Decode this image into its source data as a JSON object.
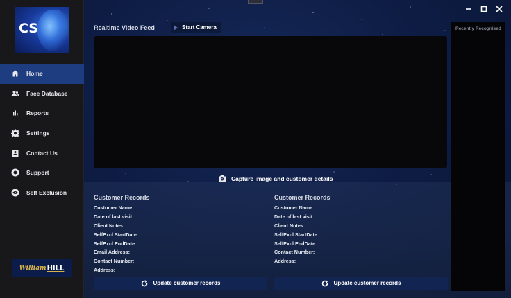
{
  "logo": {
    "text": "CS"
  },
  "brand": {
    "script": "William",
    "hill": "HILL"
  },
  "nav": {
    "items": [
      {
        "label": "Home",
        "icon": "home-icon",
        "active": true
      },
      {
        "label": "Face Database",
        "icon": "users-icon"
      },
      {
        "label": "Reports",
        "icon": "bar-chart-icon"
      },
      {
        "label": "Settings",
        "icon": "gear-icon"
      },
      {
        "label": "Contact Us",
        "icon": "contact-card-icon"
      },
      {
        "label": "Support",
        "icon": "support-icon"
      },
      {
        "label": "Self Exclusion",
        "icon": "eye-icon"
      }
    ]
  },
  "feed": {
    "title": "Realtime Video Feed",
    "start_camera_label": "Start Camera",
    "capture_label": "Capture image and customer details"
  },
  "recent": {
    "title": "Recently Recognised"
  },
  "records_left": {
    "heading": "Customer Records",
    "fields": [
      "Customer Name:",
      "Date of last visit:",
      "Client Notes:",
      "SelfExcl StartDate:",
      "SelfExcl EndDate:",
      "Email Address:",
      "Contact Number:",
      "Address:"
    ],
    "update_label": "Update customer records"
  },
  "records_right": {
    "heading": "Customer Records",
    "fields": [
      "Customer Name:",
      "Date of last visit:",
      "Client Notes:",
      "SelfExcl StartDate:",
      "SelfExcl EndDate:",
      "Contact Number:",
      "Address:"
    ],
    "update_label": "Update customer records"
  },
  "colors": {
    "sidebar_bg": "#18181b",
    "active_nav": "#1e3d80",
    "video_bg": "#08080b",
    "button_bg": "#122452",
    "brand_gold": "#d7b24a"
  }
}
